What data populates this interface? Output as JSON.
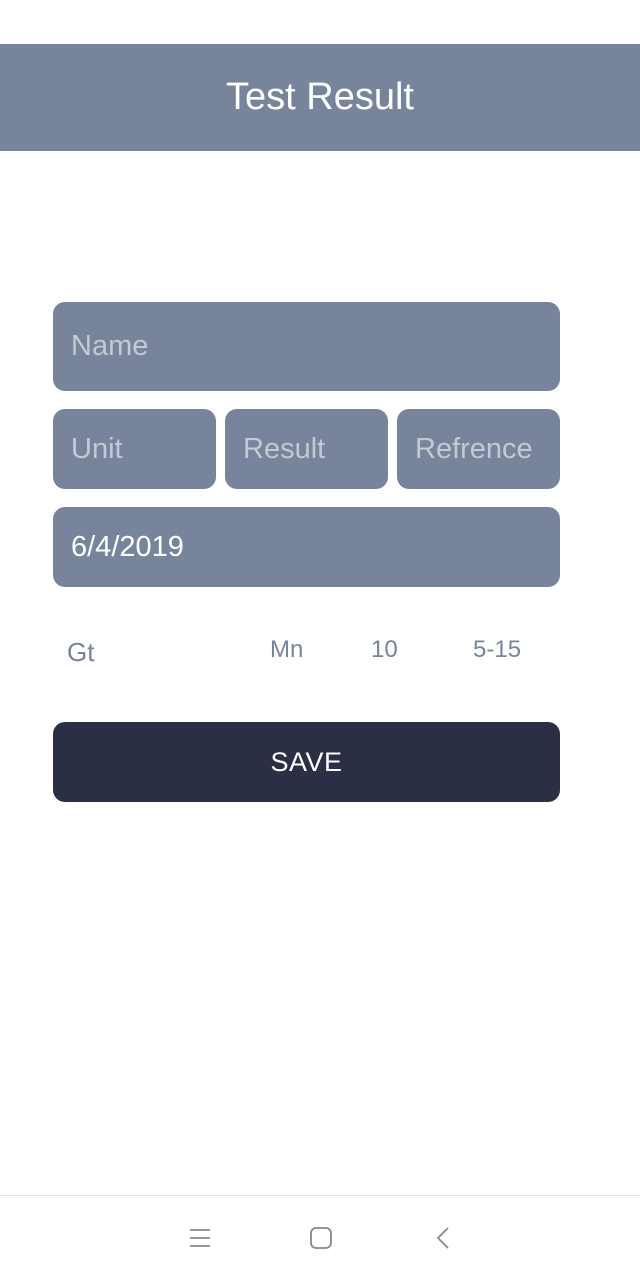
{
  "app_bar": {
    "title": "Test Result"
  },
  "form": {
    "name": {
      "placeholder": "Name",
      "value": ""
    },
    "unit": {
      "placeholder": "Unit",
      "value": ""
    },
    "result": {
      "placeholder": "Result",
      "value": ""
    },
    "reference": {
      "placeholder": "Refrence",
      "value": ""
    },
    "date": {
      "placeholder": "",
      "value": "6/4/2019"
    }
  },
  "summary": {
    "name": "Gt",
    "unit": "Mn",
    "result": "10",
    "reference": "5-15"
  },
  "save_button": {
    "label": "SAVE"
  },
  "nav_bar": {
    "icons": [
      "menu-icon",
      "home-icon",
      "back-icon"
    ]
  },
  "colors": {
    "primary": "#78849c",
    "button": "#2a2f45",
    "background": "#ffffff"
  }
}
